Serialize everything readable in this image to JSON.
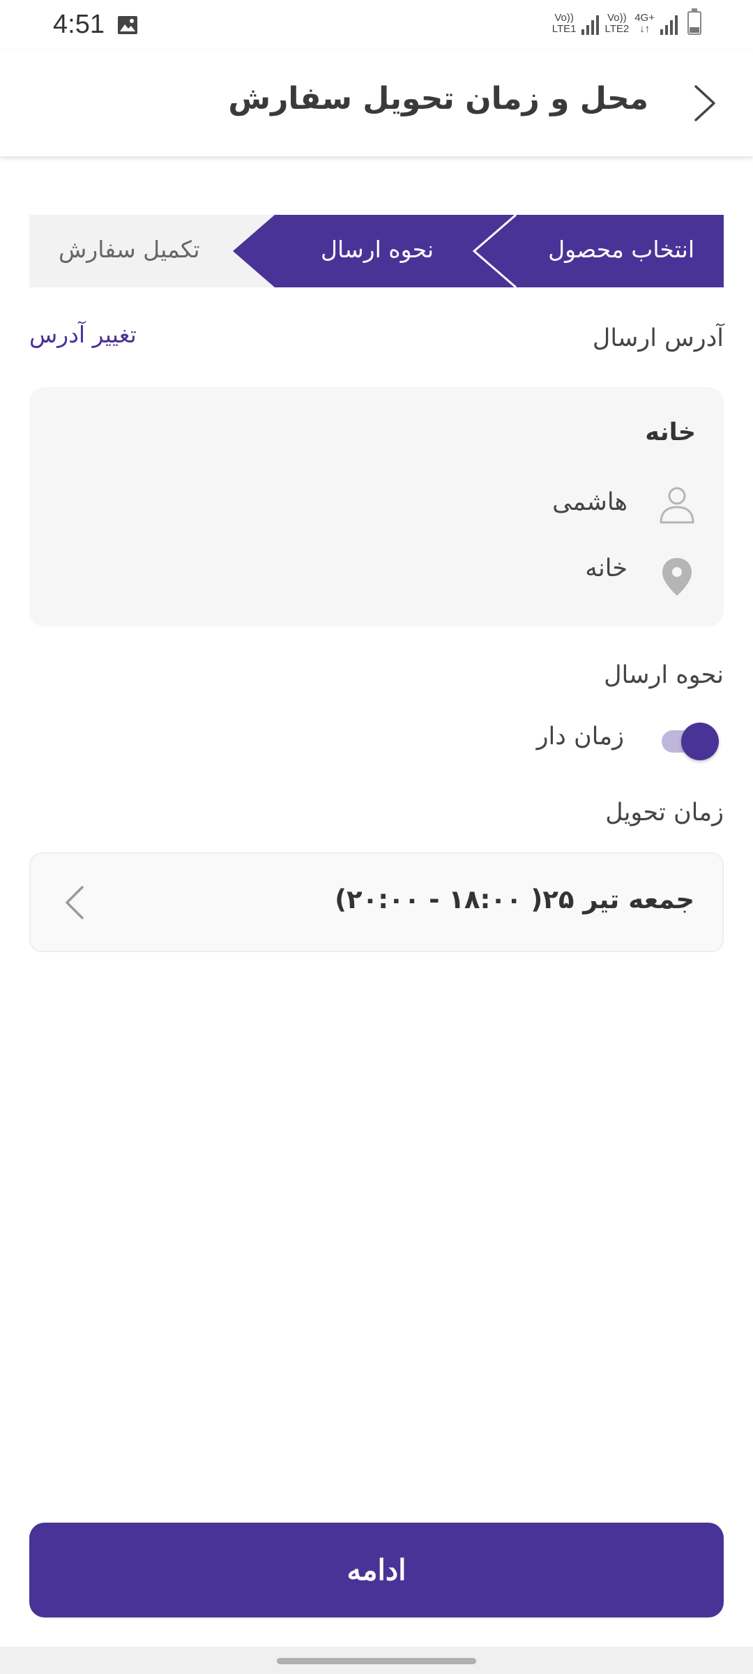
{
  "status_bar": {
    "time": "4:51",
    "sim1_label_top": "Vo))",
    "sim1_label_bottom": "LTE1",
    "sim2_label_top": "Vo))",
    "sim2_label_bottom": "LTE2",
    "network_label": "4G+",
    "icons": [
      "gallery-icon",
      "signal-icon",
      "signal-icon",
      "battery-icon"
    ]
  },
  "header": {
    "title": "محل و زمان تحویل سفارش",
    "back_icon": "chevron-right-icon"
  },
  "stepper": {
    "steps": [
      {
        "label": "انتخاب محصول",
        "state": "completed"
      },
      {
        "label": "نحوه ارسال",
        "state": "active"
      },
      {
        "label": "تکمیل سفارش",
        "state": "pending"
      }
    ]
  },
  "address": {
    "section_title": "آدرس ارسال",
    "change_link": "تغییر آدرس",
    "card": {
      "title": "خانه",
      "recipient": "هاشمی",
      "location": "خانه",
      "recipient_icon": "person-icon",
      "location_icon": "location-pin-icon"
    }
  },
  "shipping": {
    "section_title": "نحوه ارسال",
    "toggle_label": "زمان دار",
    "toggle_on": true
  },
  "delivery_time": {
    "section_title": "زمان تحویل",
    "value": "جمعه تیر ۲۵( ۱۸:۰۰ - ۲۰:۰۰)",
    "chevron_icon": "chevron-left-icon"
  },
  "actions": {
    "continue_label": "ادامه"
  },
  "colors": {
    "primary": "#4a3397",
    "primary_light": "#bfb6db",
    "card_bg": "#f6f6f6",
    "step_pending_bg": "#f2f2f2"
  }
}
